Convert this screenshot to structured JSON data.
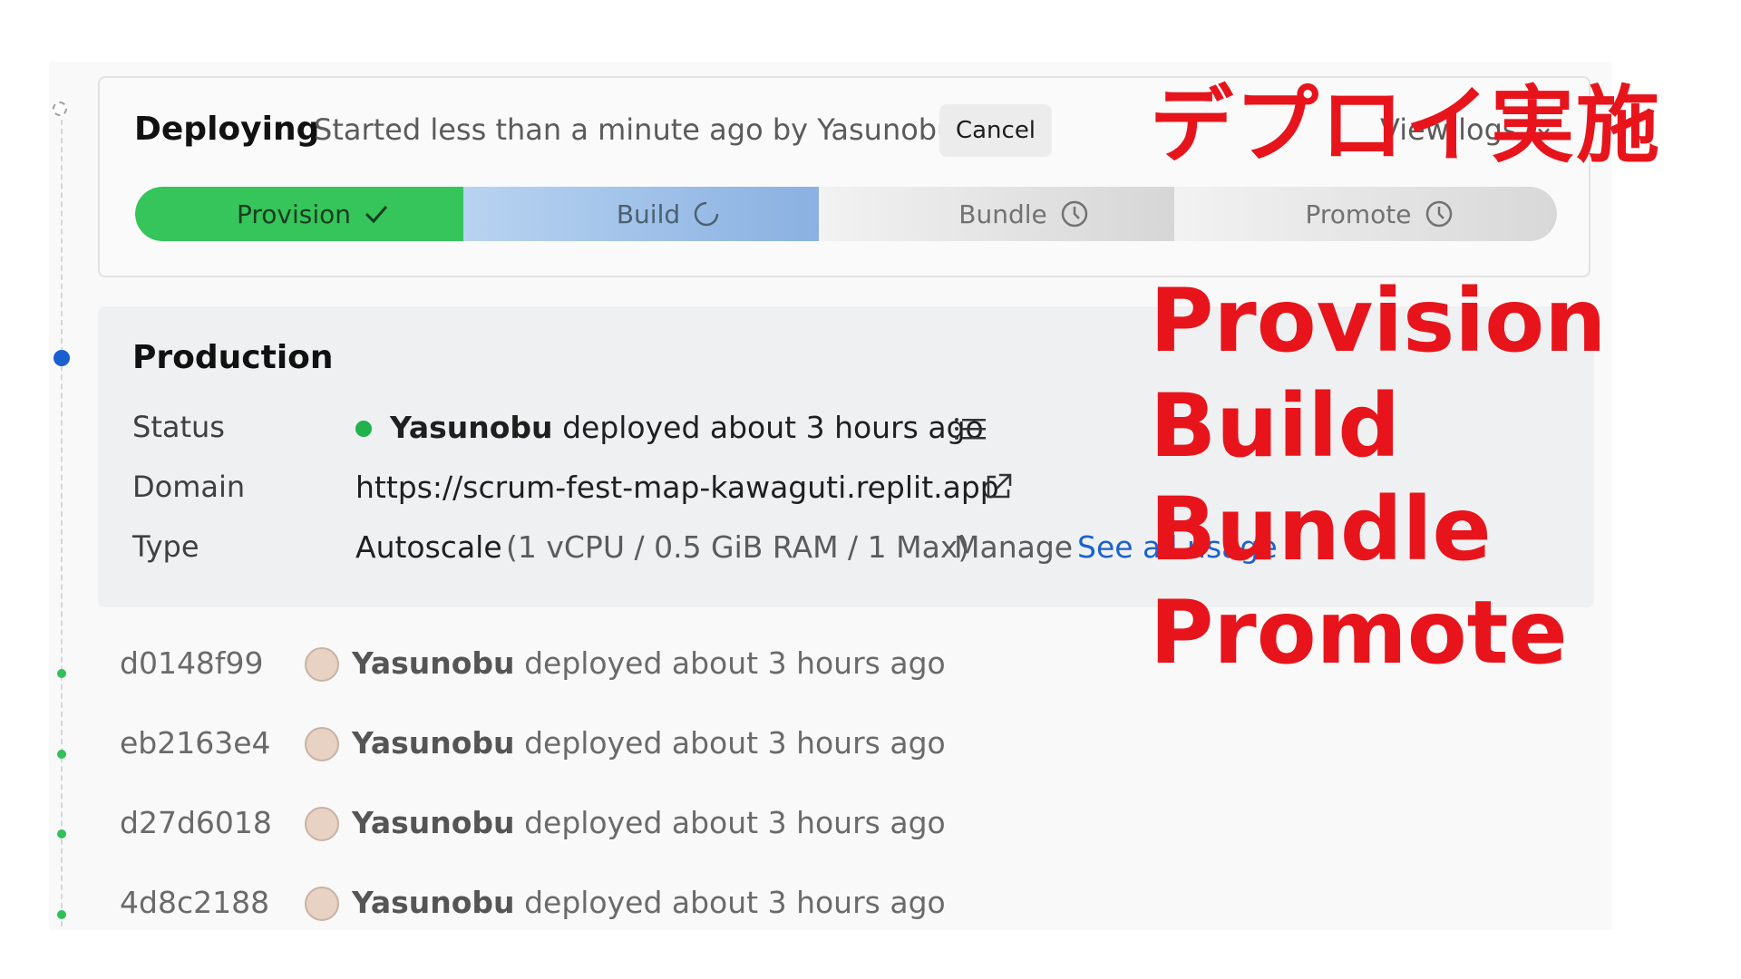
{
  "deploying": {
    "title": "Deploying",
    "subtitle": "Started less than a minute ago by Yasunobu",
    "cancel_label": "Cancel",
    "view_logs_label": "View logs",
    "stages": [
      {
        "label": "Provision",
        "state": "done",
        "icon": "check-icon"
      },
      {
        "label": "Build",
        "state": "in-progress",
        "icon": "spinner-icon"
      },
      {
        "label": "Bundle",
        "state": "pending",
        "icon": "clock-icon"
      },
      {
        "label": "Promote",
        "state": "pending",
        "icon": "clock-icon"
      }
    ]
  },
  "production": {
    "title": "Production",
    "status_label": "Status",
    "status_user": "Yasunobu",
    "status_text": "deployed about 3 hours ago",
    "domain_label": "Domain",
    "domain_value": "https://scrum-fest-map-kawaguti.replit.app",
    "type_label": "Type",
    "type_value": "Autoscale",
    "type_spec": "(1 vCPU / 0.5 GiB RAM / 1 Max)",
    "manage_label": "Manage",
    "usage_label": "See all usage"
  },
  "history": [
    {
      "hash": "d0148f99",
      "user": "Yasunobu",
      "text": "deployed about 3 hours ago"
    },
    {
      "hash": "eb2163e4",
      "user": "Yasunobu",
      "text": "deployed about 3 hours ago"
    },
    {
      "hash": "d27d6018",
      "user": "Yasunobu",
      "text": "deployed about 3 hours ago"
    },
    {
      "hash": "4d8c2188",
      "user": "Yasunobu",
      "text": "deployed about 3 hours ago"
    }
  ],
  "annotations": {
    "title_jp": "デプロイ実施",
    "stages": [
      "Provision",
      "Build",
      "Bundle",
      "Promote"
    ]
  },
  "colors": {
    "provision": "#35c55a",
    "build": "#86aee0",
    "status_green": "#22b24c",
    "timeline_blue": "#1a5fd0",
    "link_blue": "#1a62cf",
    "annotation_red": "#e8141c"
  }
}
